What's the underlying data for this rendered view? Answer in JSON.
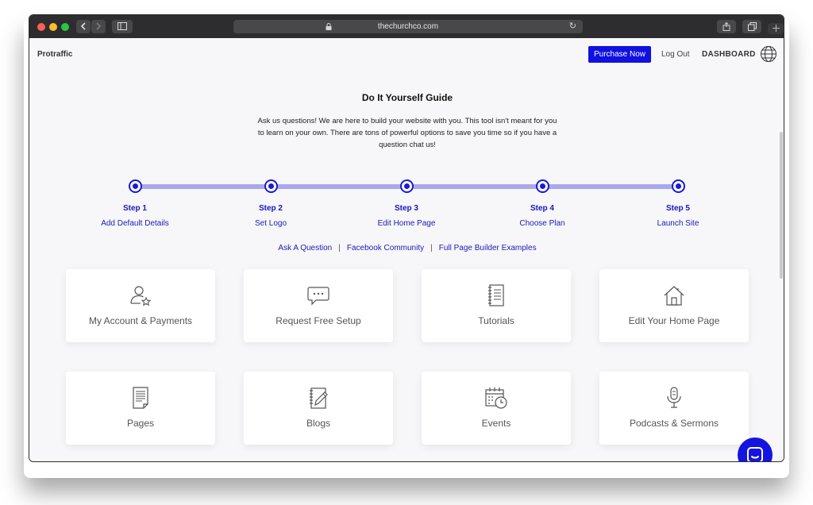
{
  "browser": {
    "url": "thechurchco.com",
    "colors": {
      "chrome": "#2d2d2f",
      "close": "#fe5f57",
      "minimize": "#febc2e",
      "zoom": "#28c840"
    }
  },
  "header": {
    "brand": "Protraffic",
    "purchase_label": "Purchase Now",
    "logout_label": "Log Out",
    "dashboard_label": "DASHBOARD",
    "accent": "#1010e0"
  },
  "guide": {
    "title": "Do It Yourself Guide",
    "description": "Ask us questions! We are here to build your website with you. This tool isn't meant for you to learn on your own. There are tons of powerful options to save you time so if you have a question chat us!",
    "steps": [
      {
        "title": "Step 1",
        "label": "Add Default Details"
      },
      {
        "title": "Step 2",
        "label": "Set Logo"
      },
      {
        "title": "Step 3",
        "label": "Edit Home Page"
      },
      {
        "title": "Step 4",
        "label": "Choose Plan"
      },
      {
        "title": "Step 5",
        "label": "Launch Site"
      }
    ],
    "links": [
      "Ask A Question",
      "Facebook Community",
      "Full Page Builder Examples"
    ],
    "link_separator": "|"
  },
  "cards": [
    {
      "label": "My Account & Payments",
      "icon": "user-star-icon"
    },
    {
      "label": "Request Free Setup",
      "icon": "chat-bubble-icon"
    },
    {
      "label": "Tutorials",
      "icon": "notebook-icon"
    },
    {
      "label": "Edit Your Home Page",
      "icon": "home-icon"
    },
    {
      "label": "Pages",
      "icon": "page-icon"
    },
    {
      "label": "Blogs",
      "icon": "pencil-notebook-icon"
    },
    {
      "label": "Events",
      "icon": "calendar-clock-icon"
    },
    {
      "label": "Podcasts & Sermons",
      "icon": "microphone-icon"
    }
  ]
}
